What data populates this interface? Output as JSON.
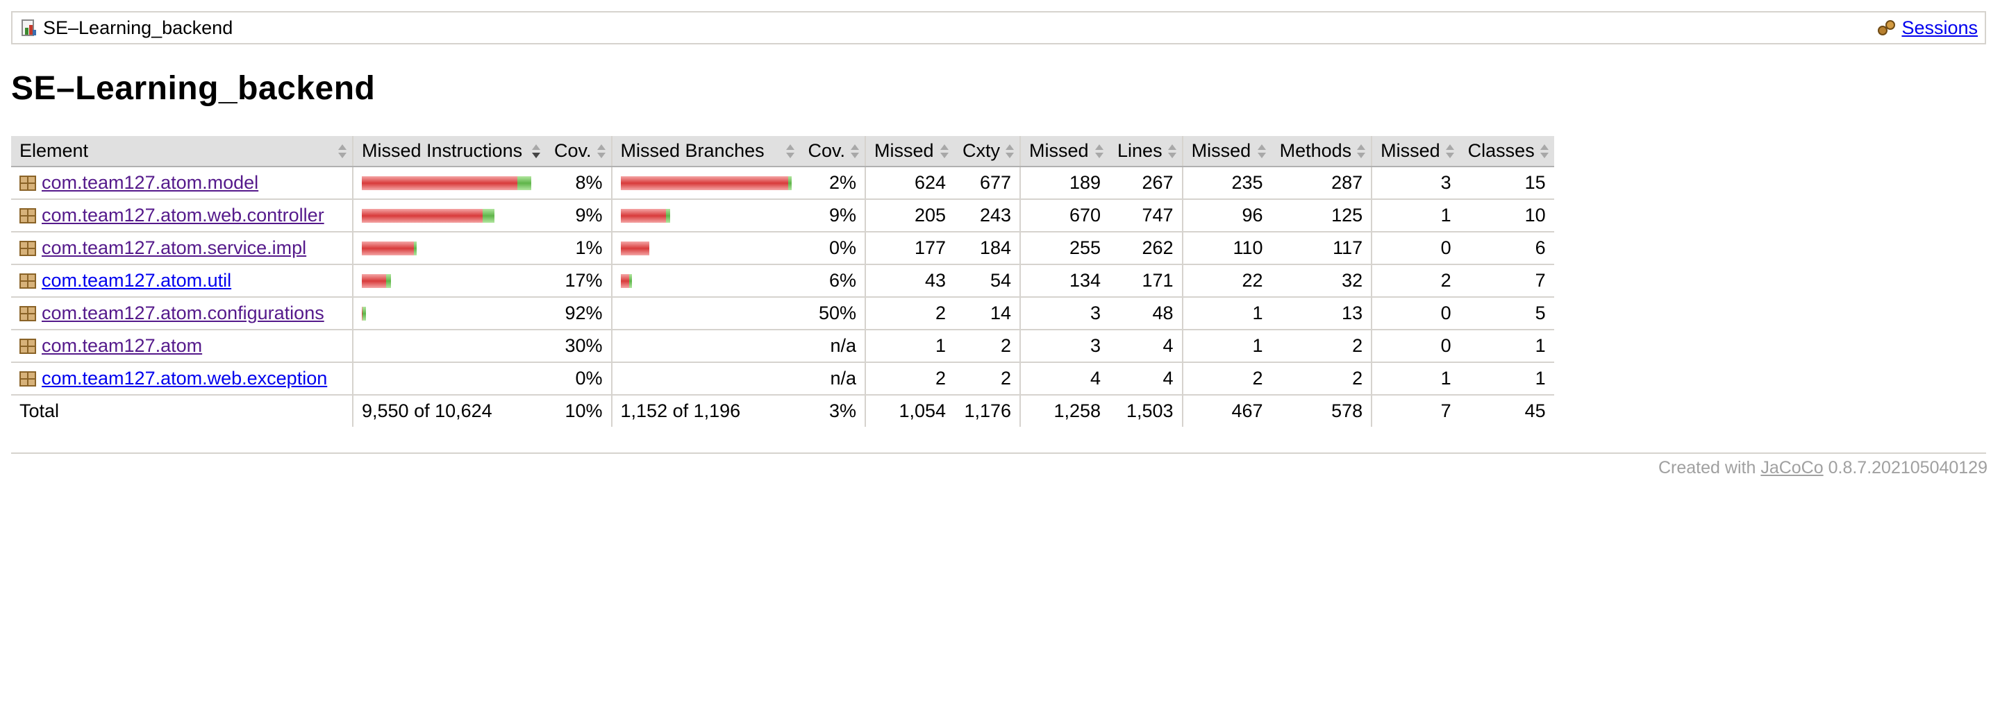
{
  "breadcrumb": {
    "report_name": "SE–Learning_backend",
    "sessions_label": "Sessions",
    "report_icon": "report-icon",
    "sessions_icon": "session-icon"
  },
  "page_title": "SE–Learning_backend",
  "colors": {
    "missed": "#d83b3b",
    "covered": "#5fb54a",
    "link": "#0000ee",
    "visited_link": "#551a8b"
  },
  "table": {
    "headers": {
      "element": "Element",
      "missed_instructions": "Missed Instructions",
      "cov_instructions": "Cov.",
      "missed_branches": "Missed Branches",
      "cov_branches": "Cov.",
      "missed_cxty": "Missed",
      "cxty": "Cxty",
      "missed_lines": "Missed",
      "lines": "Lines",
      "missed_methods": "Missed",
      "methods": "Methods",
      "missed_classes": "Missed",
      "classes": "Classes"
    },
    "rows": [
      {
        "name": "com.team127.atom.model",
        "visited": true,
        "instr_bar": {
          "missed_fraction": 0.862,
          "covered_fraction": 0.075
        },
        "instr_cov": "8%",
        "branch_bar": {
          "missed_fraction": 0.982,
          "covered_fraction": 0.02
        },
        "branch_cov": "2%",
        "missed_cxty": "624",
        "cxty": "677",
        "missed_lines": "189",
        "lines": "267",
        "missed_methods": "235",
        "methods": "287",
        "missed_classes": "3",
        "classes": "15"
      },
      {
        "name": "com.team127.atom.web.controller",
        "visited": true,
        "instr_bar": {
          "missed_fraction": 0.67,
          "covered_fraction": 0.066
        },
        "instr_cov": "9%",
        "branch_bar": {
          "missed_fraction": 0.265,
          "covered_fraction": 0.026
        },
        "branch_cov": "9%",
        "missed_cxty": "205",
        "cxty": "243",
        "missed_lines": "670",
        "lines": "747",
        "missed_methods": "96",
        "methods": "125",
        "missed_classes": "1",
        "classes": "10"
      },
      {
        "name": "com.team127.atom.service.impl",
        "visited": true,
        "instr_bar": {
          "missed_fraction": 0.29,
          "covered_fraction": 0.003
        },
        "instr_cov": "1%",
        "branch_bar": {
          "missed_fraction": 0.168,
          "covered_fraction": 0.0
        },
        "branch_cov": "0%",
        "missed_cxty": "177",
        "cxty": "184",
        "missed_lines": "255",
        "lines": "262",
        "missed_methods": "110",
        "methods": "117",
        "missed_classes": "0",
        "classes": "6"
      },
      {
        "name": "com.team127.atom.util",
        "visited": false,
        "instr_bar": {
          "missed_fraction": 0.135,
          "covered_fraction": 0.028
        },
        "instr_cov": "17%",
        "branch_bar": {
          "missed_fraction": 0.047,
          "covered_fraction": 0.003
        },
        "branch_cov": "6%",
        "missed_cxty": "43",
        "cxty": "54",
        "missed_lines": "134",
        "lines": "171",
        "missed_methods": "22",
        "methods": "32",
        "missed_classes": "2",
        "classes": "7"
      },
      {
        "name": "com.team127.atom.configurations",
        "visited": true,
        "instr_bar": {
          "missed_fraction": 0.003,
          "covered_fraction": 0.02
        },
        "instr_cov": "92%",
        "branch_bar": {
          "missed_fraction": 0,
          "covered_fraction": 0
        },
        "branch_cov": "50%",
        "missed_cxty": "2",
        "cxty": "14",
        "missed_lines": "3",
        "lines": "48",
        "missed_methods": "1",
        "methods": "13",
        "missed_classes": "0",
        "classes": "5"
      },
      {
        "name": "com.team127.atom",
        "visited": true,
        "instr_bar": {
          "missed_fraction": 0,
          "covered_fraction": 0
        },
        "instr_cov": "30%",
        "branch_bar": {
          "missed_fraction": 0,
          "covered_fraction": 0
        },
        "branch_cov": "n/a",
        "missed_cxty": "1",
        "cxty": "2",
        "missed_lines": "3",
        "lines": "4",
        "missed_methods": "1",
        "methods": "2",
        "missed_classes": "0",
        "classes": "1"
      },
      {
        "name": "com.team127.atom.web.exception",
        "visited": false,
        "instr_bar": {
          "missed_fraction": 0,
          "covered_fraction": 0
        },
        "instr_cov": "0%",
        "branch_bar": {
          "missed_fraction": 0,
          "covered_fraction": 0
        },
        "branch_cov": "n/a",
        "missed_cxty": "2",
        "cxty": "2",
        "missed_lines": "4",
        "lines": "4",
        "missed_methods": "2",
        "methods": "2",
        "missed_classes": "1",
        "classes": "1"
      }
    ],
    "total": {
      "label": "Total",
      "missed_instructions": "9,550 of 10,624",
      "instr_cov": "10%",
      "missed_branches": "1,152 of 1,196",
      "branch_cov": "3%",
      "missed_cxty": "1,054",
      "cxty": "1,176",
      "missed_lines": "1,258",
      "lines": "1,503",
      "missed_methods": "467",
      "methods": "578",
      "missed_classes": "7",
      "classes": "45"
    }
  },
  "footer": {
    "created_with": "Created with",
    "tool_name": "JaCoCo",
    "version": "0.8.7.202105040129"
  }
}
